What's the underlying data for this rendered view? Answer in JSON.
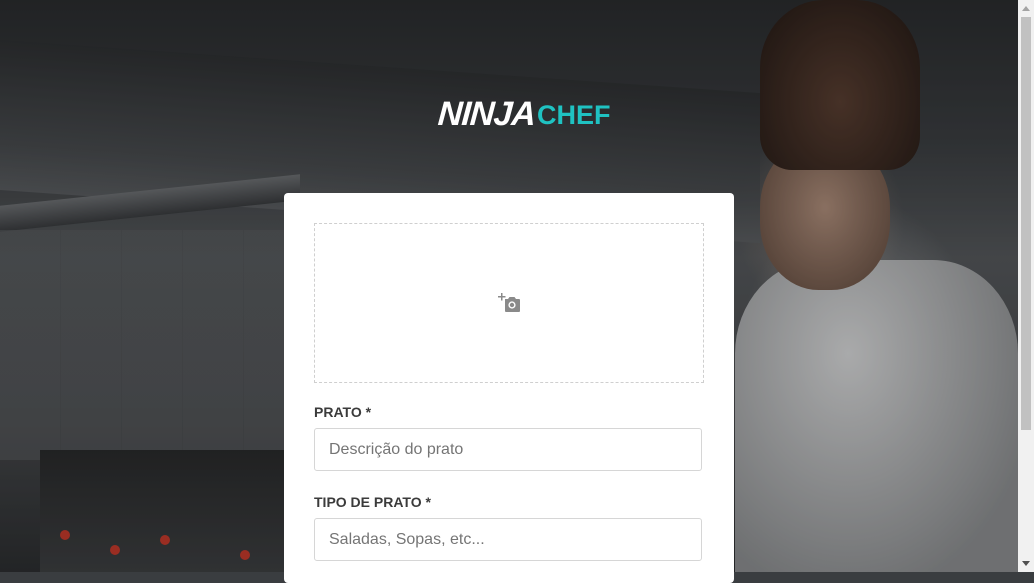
{
  "brand": {
    "logo_part1": "NINJA",
    "logo_part2": "CHEF",
    "accent_color": "#1fc2c2"
  },
  "form": {
    "thumbnail": {
      "icon": "add-photo-icon"
    },
    "fields": [
      {
        "label": "PRATO *",
        "placeholder": "Descrição do prato",
        "value": ""
      },
      {
        "label": "TIPO DE PRATO *",
        "placeholder": "Saladas, Sopas, etc...",
        "value": ""
      }
    ]
  }
}
